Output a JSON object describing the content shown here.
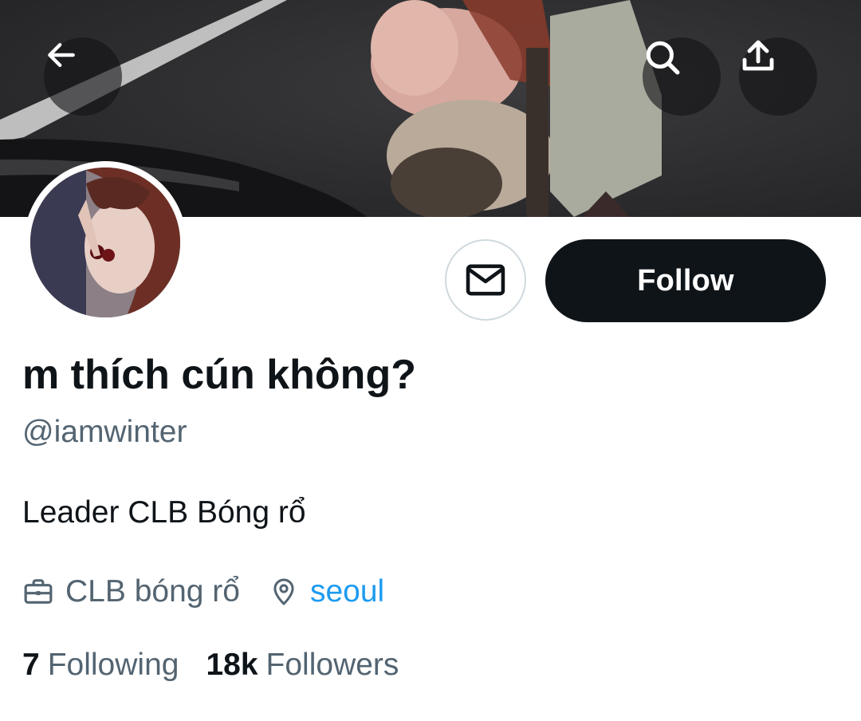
{
  "profile": {
    "display_name": "m thích cún không?",
    "handle": "@iamwinter",
    "bio": "Leader CLB Bóng rổ",
    "meta": {
      "work": "CLB bóng rổ",
      "location": "seoul"
    },
    "stats": {
      "following_count": "7",
      "following_label": "Following",
      "followers_count": "18k",
      "followers_label": "Followers"
    }
  },
  "actions": {
    "follow_label": "Follow"
  },
  "icons": {
    "back": "back-arrow-icon",
    "search": "search-icon",
    "share": "share-icon",
    "message": "envelope-icon",
    "work": "briefcase-icon",
    "location": "location-pin-icon"
  },
  "colors": {
    "text_primary": "#0f1419",
    "text_secondary": "#536471",
    "link": "#1d9bf0",
    "button_dark": "#0f1419",
    "border": "#cfd9de"
  }
}
